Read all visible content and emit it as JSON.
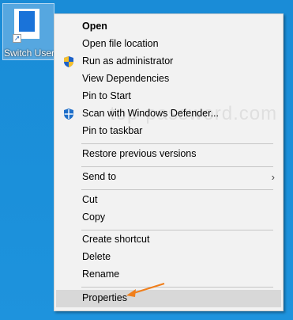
{
  "desktop_icon": {
    "label": "Switch User",
    "icon": "app-shortcut-icon"
  },
  "watermark": "top-password.com",
  "menu": {
    "items": [
      {
        "label": "Open",
        "bold": true
      },
      {
        "label": "Open file location"
      },
      {
        "label": "Run as administrator",
        "icon": "uac-shield-icon"
      },
      {
        "label": "View Dependencies"
      },
      {
        "label": "Pin to Start"
      },
      {
        "label": "Scan with Windows Defender...",
        "icon": "windows-defender-icon"
      },
      {
        "label": "Pin to taskbar"
      },
      {
        "label": "Restore previous versions"
      },
      {
        "label": "Send to",
        "submenu": true
      },
      {
        "label": "Cut"
      },
      {
        "label": "Copy"
      },
      {
        "label": "Create shortcut"
      },
      {
        "label": "Delete"
      },
      {
        "label": "Rename"
      },
      {
        "label": "Properties",
        "highlighted": true
      }
    ]
  },
  "annotation": {
    "arrow_color": "#f07f1c"
  },
  "colors": {
    "desktop": "#1b8dd8",
    "menu_bg": "#f2f2f2",
    "highlight": "#d8d8d8"
  }
}
